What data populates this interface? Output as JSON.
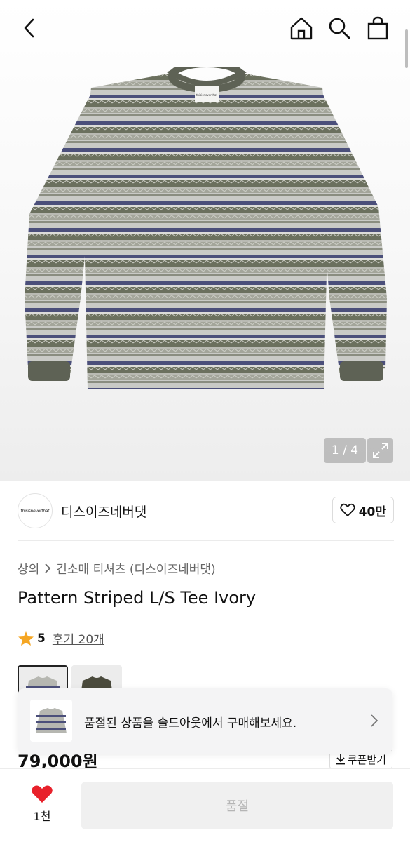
{
  "header": {
    "back_icon": "chevron-left-icon",
    "home_icon": "home-icon",
    "search_icon": "search-icon",
    "bag_icon": "shopping-bag-icon"
  },
  "gallery": {
    "pager": "1 / 4",
    "expand_icon": "expand-icon",
    "shirt_logo_text": "thisisneverthat"
  },
  "brand": {
    "logo_text": "thisisneverthat",
    "name": "디스이즈네버댓",
    "likes": "40만",
    "like_icon": "heart-outline-icon"
  },
  "breadcrumb": {
    "level1": "상의",
    "separator_icon": "chevron-right-icon",
    "level2": "긴소매 티셔츠 (디스이즈네버댓)"
  },
  "product": {
    "title": "Pattern Striped L/S Tee Ivory",
    "rating": "5",
    "reviews": "후기 20개",
    "star_color": "#f5a623",
    "price": "79,000원",
    "coupon": "쿠폰받기"
  },
  "toast": {
    "message": "품절된 상품을 솔드아웃에서 구매해보세요."
  },
  "bottom": {
    "wish_count": "1천",
    "heart_color": "#e8212b",
    "buy_label": "품절"
  }
}
